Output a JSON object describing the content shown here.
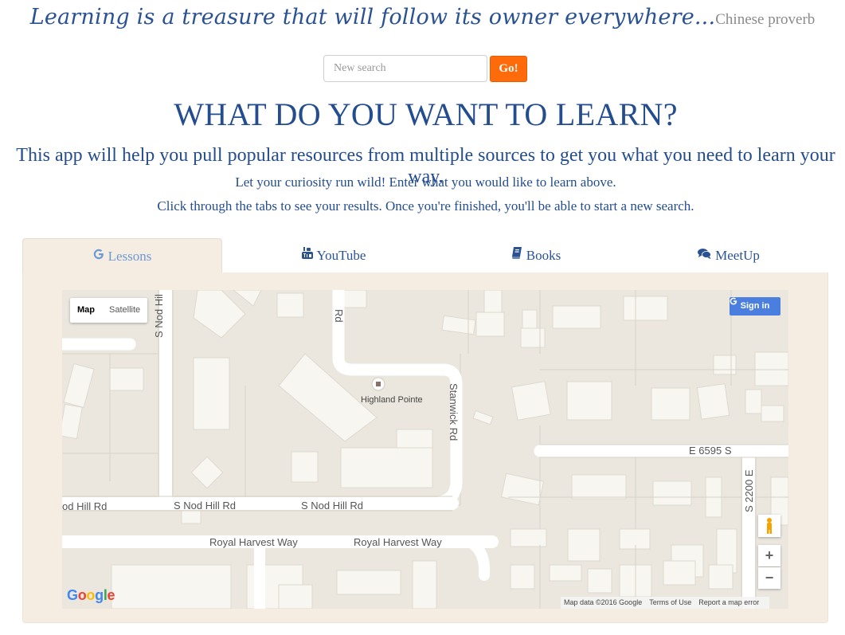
{
  "quote": {
    "text": "Learning is a treasure that will follow its owner everywhere...",
    "source": "Chinese proverb"
  },
  "search": {
    "placeholder": "New search",
    "button_label": "Go!"
  },
  "headline": "WHAT DO YOU WANT TO LEARN?",
  "intro": {
    "lead": "This app will help you pull popular resources from multiple sources to get you what you need to learn your way.",
    "line1": "Let your curiosity run wild! Enter what you would like to learn above.",
    "line2": "Click through the tabs to see your results. Once you're finished, you'll be able to start a new search."
  },
  "tabs": [
    {
      "label": "Lessons",
      "icon": "google-icon",
      "active": true
    },
    {
      "label": "YouTube",
      "icon": "youtube-icon",
      "active": false
    },
    {
      "label": "Books",
      "icon": "book-icon",
      "active": false
    },
    {
      "label": "MeetUp",
      "icon": "comments-icon",
      "active": false
    }
  ],
  "map": {
    "type_controls": [
      {
        "label": "Map",
        "active": true
      },
      {
        "label": "Satellite",
        "active": false
      }
    ],
    "sign_in_label": "Sign in",
    "place_label": "Highland Pointe",
    "street_labels": {
      "nod_hill_1": "od Hill Rd",
      "nod_hill_2": "S Nod Hill Rd",
      "nod_hill_3": "S Nod Hill Rd",
      "nod_hill_vertical": "S Nod Hil",
      "rd_vertical": "Rd",
      "stanwick": "Stanwick Rd",
      "e6595": "E 6595 S",
      "s2200": "S 2200 E",
      "royal_1": "Royal Harvest Way",
      "royal_2": "Royal Harvest Way"
    },
    "zoom_in": "+",
    "zoom_out": "−",
    "google_logo": "Google",
    "attribution": [
      "Map data ©2016 Google",
      "Terms of Use",
      "Report a map error"
    ]
  }
}
